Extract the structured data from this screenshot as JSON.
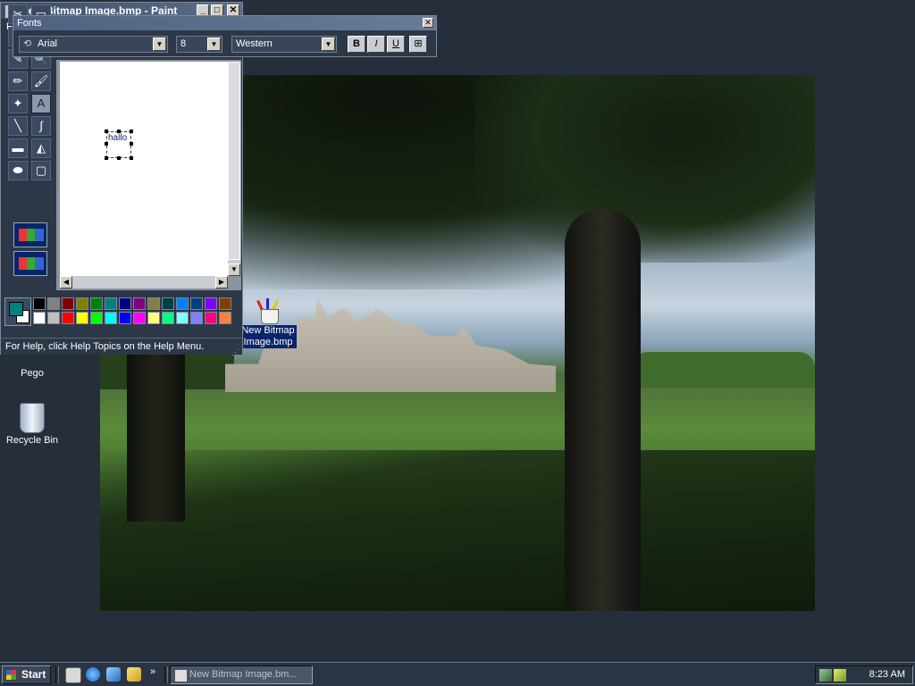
{
  "paint_window": {
    "title": "New Bitmap Image.bmp - Paint",
    "menu_first": "F",
    "buttons": {
      "minimize": "_",
      "maximize": "□",
      "close": "✕"
    }
  },
  "fonts_toolbar": {
    "title": "Fonts",
    "font_name": "Arial",
    "font_size": "8",
    "script": "Western",
    "bold": "B",
    "italic": "I",
    "underline": "U",
    "close": "✕"
  },
  "tools": [
    {
      "name": "free-form-select",
      "glyph": "✂"
    },
    {
      "name": "select",
      "glyph": "▭"
    },
    {
      "name": "eraser",
      "glyph": "▱"
    },
    {
      "name": "fill-with-color",
      "glyph": "◈"
    },
    {
      "name": "pick-color",
      "glyph": "✎"
    },
    {
      "name": "magnifier",
      "glyph": "🔍"
    },
    {
      "name": "pencil",
      "glyph": "✏"
    },
    {
      "name": "brush",
      "glyph": "🖌"
    },
    {
      "name": "airbrush",
      "glyph": "✦"
    },
    {
      "name": "text",
      "glyph": "A"
    },
    {
      "name": "line",
      "glyph": "╲"
    },
    {
      "name": "curve",
      "glyph": "∫"
    },
    {
      "name": "rectangle",
      "glyph": "▬"
    },
    {
      "name": "polygon",
      "glyph": "◭"
    },
    {
      "name": "ellipse",
      "glyph": "⬬"
    },
    {
      "name": "rounded-rectangle",
      "glyph": "▢"
    }
  ],
  "canvas": {
    "text": "hallo"
  },
  "palette": {
    "foreground": "#008080",
    "background": "#ffffff",
    "top_row": [
      "#000000",
      "#808080",
      "#800000",
      "#808000",
      "#008000",
      "#008080",
      "#000080",
      "#800080",
      "#808040",
      "#004040",
      "#0080ff",
      "#004080",
      "#8000ff",
      "#804000"
    ],
    "bottom_row": [
      "#ffffff",
      "#c0c0c0",
      "#ff0000",
      "#ffff00",
      "#00ff00",
      "#00ffff",
      "#0000ff",
      "#ff00ff",
      "#ffff80",
      "#00ff80",
      "#80ffff",
      "#8080ff",
      "#ff0080",
      "#ff8040"
    ]
  },
  "status_bar": "For Help, click Help Topics on the Help Menu.",
  "desktop_icons": {
    "bitmap_label_line1": "New Bitmap",
    "bitmap_label_line2": "Image.bmp",
    "pego_label": "Pego",
    "recycle_label": "Recycle Bin"
  },
  "taskbar": {
    "start_label": "Start",
    "chevron": "»",
    "active_task": "New Bitmap Image.bm...",
    "clock": "8:23 AM"
  }
}
